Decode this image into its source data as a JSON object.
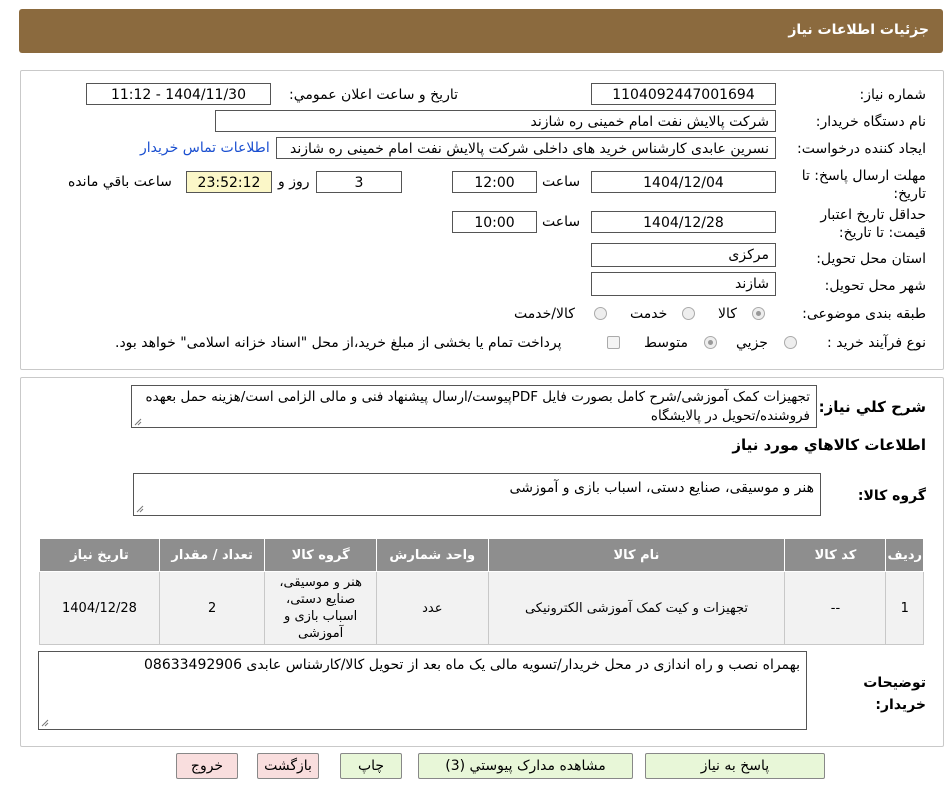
{
  "header": {
    "title": "جزئیات اطلاعات نیاز"
  },
  "need_info": {
    "need_number_label": "شماره نیاز:",
    "need_number": "1104092447001694",
    "announce_label": "تاریخ و ساعت اعلان عمومي:",
    "announce_value": "1404/11/30 - 11:12",
    "buyer_org_label": "نام دستگاه خريدار:",
    "buyer_org": "شرکت پالایش نفت امام خمینی  ره  شازند",
    "requester_label": "ايجاد کننده درخواست:",
    "requester": "نسرین عابدی کارشناس خرید های داخلی  شرکت پالایش نفت امام خمینی  ره  شازند",
    "contact_link": "اطلاعات تماس خريدار",
    "deadline_label": "مهلت ارسال پاسخ: تا تاریخ:",
    "deadline_date": "1404/12/04",
    "time_label": "ساعت",
    "deadline_time": "12:00",
    "days_value": "3",
    "days_label": "روز و",
    "remaining_time": "23:52:12",
    "remaining_label": "ساعت باقي مانده",
    "validity_label": "حداقل تاريخ اعتبار قیمت: تا تاریخ:",
    "validity_date": "1404/12/28",
    "validity_time": "10:00",
    "province_label": "استان محل تحويل:",
    "province": "مرکزی",
    "city_label": "شهر محل تحويل:",
    "city": "شازند",
    "category_label": "طبقه بندی موضوعی:",
    "category_options": [
      "کالا",
      "خدمت",
      "کالا/خدمت"
    ],
    "process_label": "نوع فرآيند خريد :",
    "process_options": [
      "جزيي",
      "متوسط"
    ],
    "payment_note": "پرداخت تمام يا بخشی از مبلغ خريد،از محل \"اسناد خزانه اسلامی\" خواهد بود."
  },
  "description": {
    "label": "شرح کلي نياز:",
    "text": "تجهیزات کمک آموزشی/شرح کامل بصورت فایل PDFپیوست/ارسال پیشنهاد فنی و مالی الزامی است/هزینه حمل بعهده فروشنده/تحویل در پالایشگاه"
  },
  "goods": {
    "section_title": "اطلاعات کالاهاي مورد نياز",
    "group_label": "گروه کالا:",
    "group_value": "هنر و موسیقی، صنایع دستی، اسباب بازی و آموزشی",
    "columns": [
      "رديف",
      "کد کالا",
      "نام کالا",
      "واحد شمارش",
      "گروه کالا",
      "تعداد / مقدار",
      "تاريخ نياز"
    ],
    "rows": [
      {
        "index": "1",
        "code": "--",
        "name": "تجهیزات و کیت کمک آموزشی الکترونیکی",
        "unit": "عدد",
        "group": "هنر و موسیقی، صنایع دستی، اسباب بازی و آموزشی",
        "qty": "2",
        "date": "1404/12/28"
      }
    ]
  },
  "buyer_notes": {
    "label": "توضيحات خريدار:",
    "text": "بهمراه نصب و راه اندازی در محل خریدار/تسویه مالی یک ماه بعد از تحویل کالا/کارشناس عابدی 08633492906"
  },
  "buttons": {
    "respond": "پاسخ به نياز",
    "view_docs": "مشاهده مدارک پيوستي (3)",
    "print": "چاپ",
    "back": "بازگشت",
    "exit": "خروج"
  },
  "colors": {
    "header": "#8b6a3e",
    "table_header": "#8e8e8e",
    "link": "#1a4fd0"
  }
}
